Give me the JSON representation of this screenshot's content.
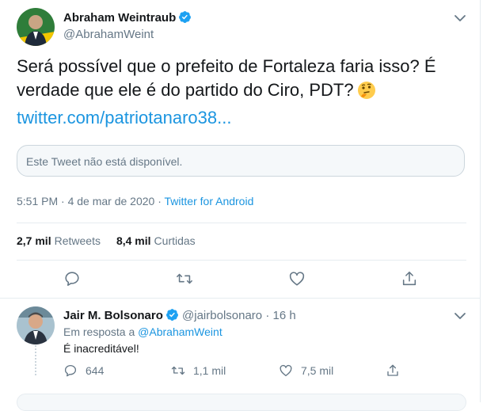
{
  "main_tweet": {
    "author_name": "Abraham Weintraub",
    "author_handle": "@AbrahamWeint",
    "text": "Será possível que o prefeito de Fortaleza faria isso? É verdade que ele é do partido do Ciro, PDT?",
    "link": "twitter.com/patriotanaro38...",
    "quoted_notice": "Este Tweet não está disponível.",
    "timestamp": "5:51 PM · 4 de mar de 2020",
    "separator": "·",
    "source": "Twitter for Android",
    "retweets_count": "2,7 mil",
    "retweets_label": "Retweets",
    "likes_count": "8,4 mil",
    "likes_label": "Curtidas"
  },
  "reply": {
    "author_name": "Jair M. Bolsonaro",
    "author_handle": "@jairbolsonaro",
    "time_ago": "· 16 h",
    "replying_prefix": "Em resposta a",
    "replying_to": "@AbrahamWeint",
    "text": "É inacreditável!",
    "reply_count": "644",
    "retweet_count": "1,1 mil",
    "like_count": "7,5 mil"
  },
  "colors": {
    "link": "#1b95e0",
    "secondary_text": "#657786",
    "verified": "#1da1f2",
    "border": "#e6ecf0"
  },
  "icons": [
    "verified-badge-icon",
    "chevron-down-icon",
    "thinking-face-emoji",
    "reply-icon",
    "retweet-icon",
    "like-icon",
    "share-icon"
  ]
}
